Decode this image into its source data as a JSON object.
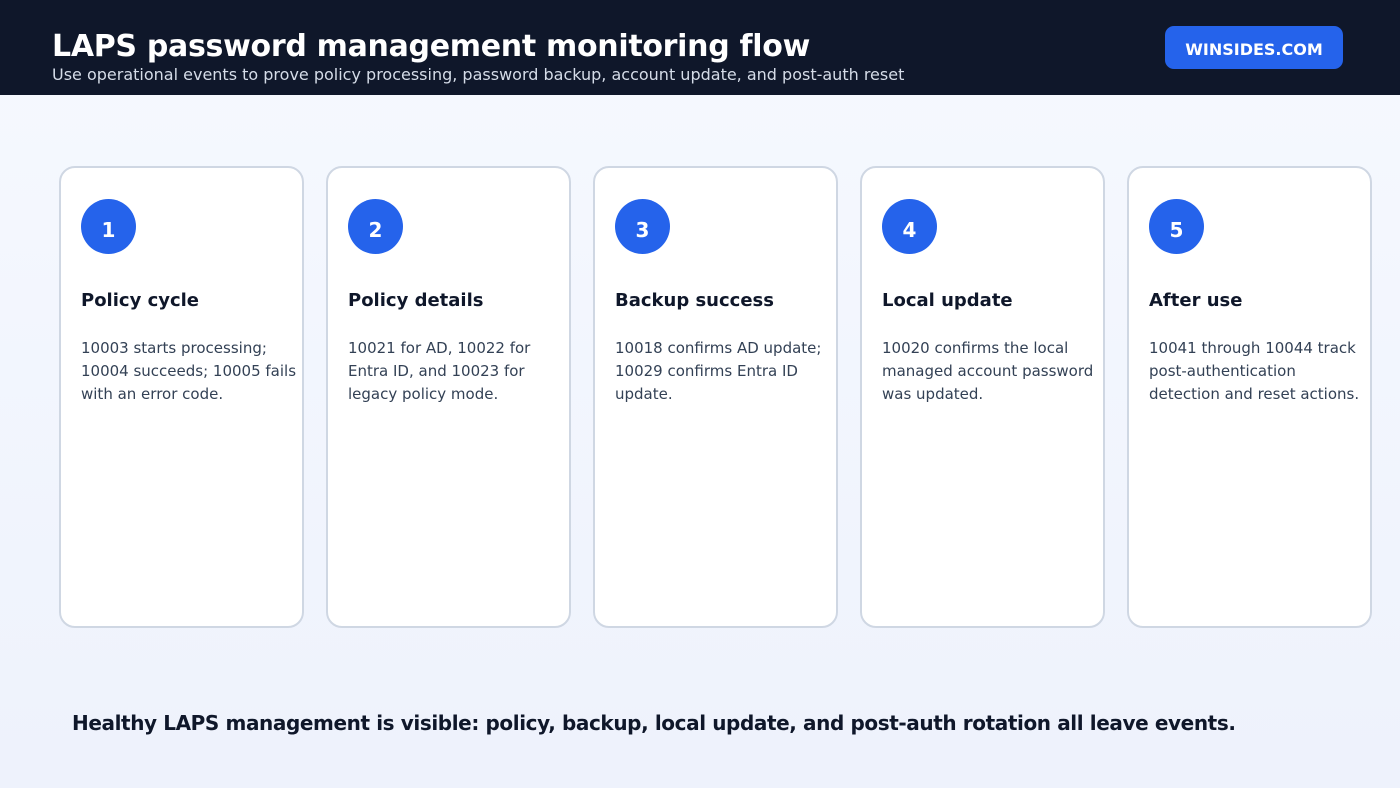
{
  "header": {
    "title": "LAPS password management monitoring flow",
    "subtitle": "Use operational events to prove policy processing, password backup, account update, and post-auth reset",
    "brand": "WINSIDES.COM"
  },
  "steps": [
    {
      "number": "1",
      "title": "Policy cycle",
      "body": "10003 starts processing; 10004 succeeds; 10005 fails with an error code."
    },
    {
      "number": "2",
      "title": "Policy details",
      "body": "10021 for AD, 10022 for Entra ID, and 10023 for legacy policy mode."
    },
    {
      "number": "3",
      "title": "Backup success",
      "body": "10018 confirms AD update; 10029 confirms Entra ID update."
    },
    {
      "number": "4",
      "title": "Local update",
      "body": "10020 confirms the local managed account password was updated."
    },
    {
      "number": "5",
      "title": "After use",
      "body": "10041 through 10044 track post-authentication detection and reset actions."
    }
  ],
  "footer": "Healthy LAPS management is visible: policy, backup, local update, and post-auth rotation all leave events.",
  "colors": {
    "header_bg": "#0f172a",
    "accent": "#2563eb",
    "card_border": "#cfd7e3",
    "text_dark": "#0f172a",
    "text_body": "#334155"
  }
}
